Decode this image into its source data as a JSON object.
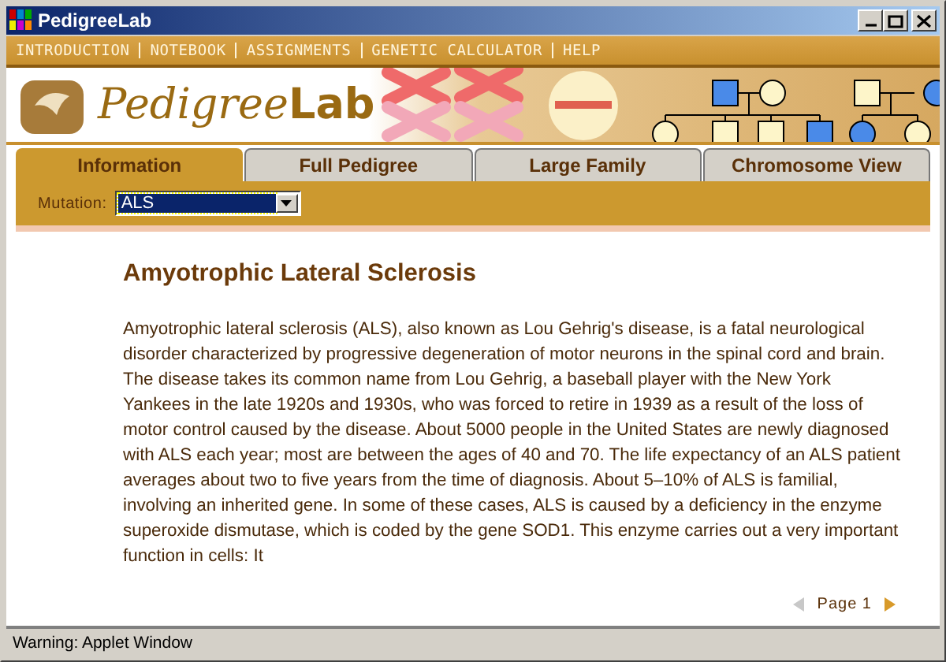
{
  "window": {
    "title": "PedigreeLab"
  },
  "menu": [
    "INTRODUCTION",
    "NOTEBOOK",
    "ASSIGNMENTS",
    "GENETIC CALCULATOR",
    "HELP"
  ],
  "logo": {
    "text": "Pedigree**Lab**"
  },
  "tabs": [
    {
      "label": "Information",
      "selected": true
    },
    {
      "label": "Full Pedigree",
      "selected": false
    },
    {
      "label": "Large Family",
      "selected": false
    },
    {
      "label": "Chromosome View",
      "selected": false
    }
  ],
  "mutation": {
    "label": "Mutation:",
    "value": "ALS"
  },
  "article": {
    "title": "Amyotrophic Lateral Sclerosis",
    "body": "Amyotrophic lateral sclerosis (ALS), also known as Lou Gehrig's disease, is a fatal neurological disorder characterized by progressive degeneration of motor neurons in the spinal cord and brain. The disease takes its common name from Lou Gehrig, a baseball player with the New York Yankees in the late 1920s and 1930s, who was forced to retire in 1939 as a result of the loss of motor control caused by the disease. About 5000 people in the United States are newly diagnosed with ALS each year; most are between the ages of 40 and 70. The life expectancy of an ALS patient averages about two to five years from the time of diagnosis. About 5–10% of ALS is familial, involving an inherited gene. In some of these cases, ALS is caused by a deficiency in the enzyme superoxide dismutase, which is coded by the gene SOD1. This enzyme carries out a very important function in cells:  It"
  },
  "pager": {
    "label": "Page 1",
    "prev_enabled": false,
    "next_enabled": true
  },
  "status_bar": {
    "text": "Warning: Applet Window"
  }
}
